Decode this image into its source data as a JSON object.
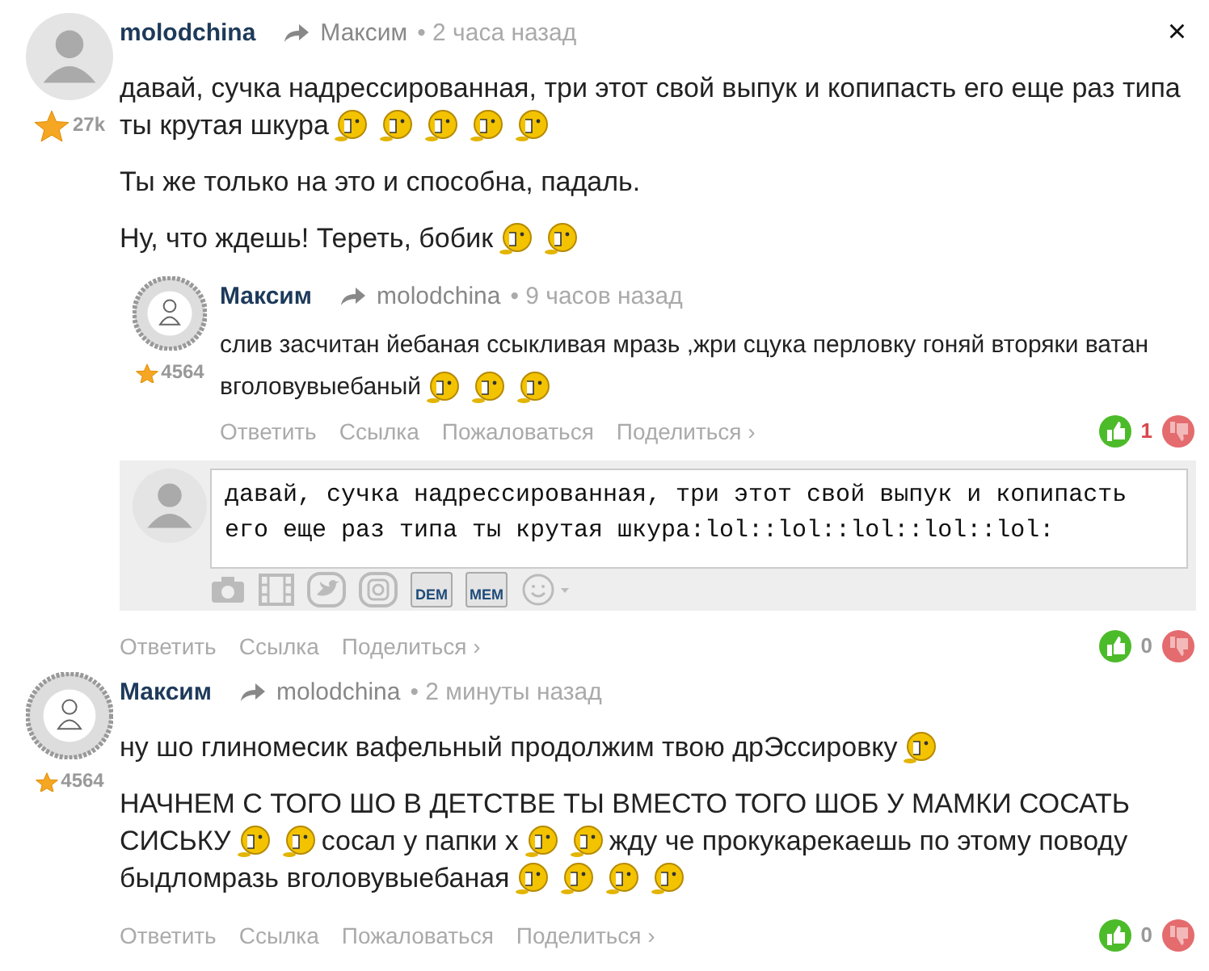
{
  "comments": [
    {
      "author": "molodchina",
      "reply_to": "Максим",
      "time": "• 2 часа назад",
      "avatar": {
        "kind": "silhouette"
      },
      "star": {
        "kind": "large"
      },
      "rating": "27k",
      "close": "×",
      "paragraphs": [
        [
          [
            {
              "kind": "text",
              "text": "давай, сучка надрессированная, три этот свой выпук и копипасть его еще раз типа"
            }
          ],
          [
            {
              "kind": "text",
              "text": "ты крутая шкура"
            },
            {
              "kind": "smiley"
            },
            {
              "kind": "smiley"
            },
            {
              "kind": "smiley"
            },
            {
              "kind": "smiley"
            },
            {
              "kind": "smiley"
            }
          ]
        ],
        [
          [
            {
              "kind": "text",
              "text": "Ты же только на это и способна, падаль."
            }
          ]
        ],
        [
          [
            {
              "kind": "text",
              "text": "Ну, что ждешь! Тереть, бобик"
            },
            {
              "kind": "smiley"
            },
            {
              "kind": "smiley"
            }
          ]
        ]
      ],
      "replies": [
        {
          "author": "Максим",
          "reply_to": "molodchina",
          "time": "• 9 часов назад",
          "avatar": {
            "kind": "pattern"
          },
          "star": {
            "kind": "small"
          },
          "rating": "4564",
          "paragraphs": [
            [
              [
                {
                  "kind": "text",
                  "text": "слив засчитан йебаная ссыкливая мразь ,жри сцука перловку гоняй вторяки ватан"
                }
              ],
              [
                {
                  "kind": "text",
                  "text": "вголовувыебаный"
                },
                {
                  "kind": "smiley"
                },
                {
                  "kind": "smiley"
                },
                {
                  "kind": "smiley"
                }
              ]
            ]
          ],
          "actions": [
            "Ответить",
            "Ссылка",
            "Пожаловаться",
            "Поделиться ›"
          ],
          "votes": {
            "count": "1",
            "highlighted": true
          }
        }
      ],
      "reply_form": {
        "avatar": {
          "kind": "silhouette"
        },
        "value": "давай, сучка надрессированная, три этот свой выпук и копипасть его еще раз типа ты крутая шкура:lol::lol::lol::lol::lol:",
        "toolbar_labels": [
          "DEM",
          "MEM"
        ]
      },
      "actions": [
        "Ответить",
        "Ссылка",
        "Поделиться ›"
      ],
      "votes": {
        "count": "0",
        "highlighted": false
      }
    },
    {
      "author": "Максим",
      "reply_to": "molodchina",
      "time": "• 2 минуты назад",
      "avatar": {
        "kind": "pattern"
      },
      "star": {
        "kind": "small"
      },
      "rating": "4564",
      "paragraphs": [
        [
          [
            {
              "kind": "text",
              "text": "ну шо глиномесик вафельный продолжим твою дрЭссировку"
            },
            {
              "kind": "smiley"
            }
          ]
        ],
        [
          [
            {
              "kind": "text",
              "text": "НАЧНЕМ С ТОГО ШО В ДЕТСТВЕ ТЫ ВМЕСТО ТОГО ШОБ У МАМКИ СОСАТЬ"
            }
          ],
          [
            {
              "kind": "text",
              "text": "СИСЬКУ"
            },
            {
              "kind": "smiley"
            },
            {
              "kind": "smiley"
            },
            {
              "kind": "text",
              "text": "сосал у папки х"
            },
            {
              "kind": "smiley"
            },
            {
              "kind": "smiley"
            },
            {
              "kind": "text",
              "text": "жду че прокукарекаешь по этому поводу"
            }
          ],
          [
            {
              "kind": "text",
              "text": "быдломразь вголовувыебаная"
            },
            {
              "kind": "smiley"
            },
            {
              "kind": "smiley"
            },
            {
              "kind": "smiley"
            },
            {
              "kind": "smiley"
            }
          ]
        ]
      ],
      "actions": [
        "Ответить",
        "Ссылка",
        "Пожаловаться",
        "Поделиться ›"
      ],
      "votes": {
        "count": "0",
        "highlighted": false
      }
    }
  ]
}
